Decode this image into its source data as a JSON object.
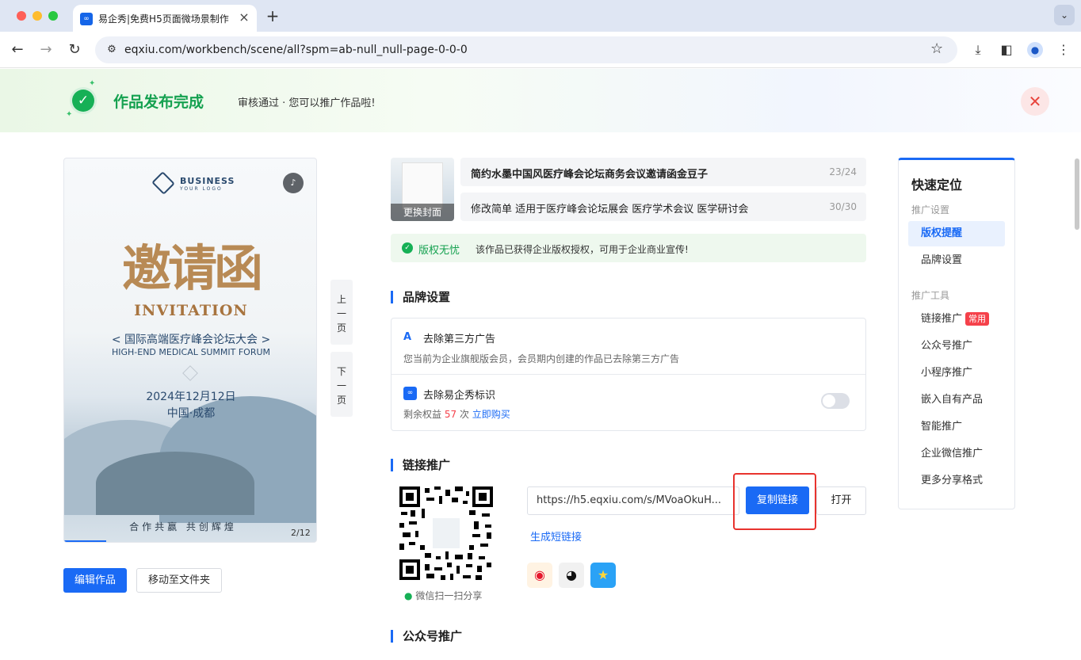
{
  "browser": {
    "tab_title": "易企秀|免费H5页面微场景制作",
    "tab_favicon": "∞",
    "url": "eqxiu.com/workbench/scene/all?spm=ab-null_null-page-0-0-0"
  },
  "banner": {
    "title": "作品发布完成",
    "subtitle": "审核通过 · 您可以推广作品啦!"
  },
  "preview": {
    "logo_top": "BUSINESS",
    "logo_bottom": "YOUR LOGO",
    "headline": "邀请函",
    "invitation": "INVITATION",
    "forum_cn": "< 国际高端医疗峰会论坛大会 >",
    "forum_en": "HIGH-END MEDICAL SUMMIT FORUM",
    "date": "2024年12月12日",
    "city": "中国·成都",
    "slogan": "合作共赢  共创辉煌",
    "page_indicator": "2/12",
    "progress": 0.167
  },
  "pager": {
    "prev": "上一页",
    "next": "下一页"
  },
  "actions": {
    "edit": "编辑作品",
    "move": "移动至文件夹"
  },
  "work": {
    "cover_button": "更换封面",
    "title": "简约水墨中国风医疗峰会论坛商务会议邀请函金豆子",
    "title_count": "23/24",
    "description": "修改简单 适用于医疗峰会论坛展会  医疗学术会议 医学研讨会",
    "description_count": "30/30",
    "copyright_label": "版权无忧",
    "copyright_text": "该作品已获得企业版权授权，可用于企业商业宣传!"
  },
  "brand": {
    "heading": "品牌设置",
    "remove_ads_title": "去除第三方广告",
    "remove_ads_desc": "您当前为企业旗舰版会员，会员期内创建的作品已去除第三方广告",
    "remove_logo_title": "去除易企秀标识",
    "remaining_label": "剩余权益",
    "remaining_count": "57",
    "remaining_unit": "次",
    "buy_link": "立即购买"
  },
  "link_promo": {
    "heading": "链接推广",
    "link_value": "https://h5.eqxiu.com/s/MVoaOkuH...",
    "copy_button": "复制链接",
    "open_button": "打开",
    "short_link": "生成短链接",
    "wechat_scan": "微信扫一扫分享"
  },
  "wechat_heading": "公众号推广",
  "quicknav": {
    "title": "快速定位",
    "group1": "推广设置",
    "group2": "推广工具",
    "items_settings": [
      "版权提醒",
      "品牌设置"
    ],
    "items_tools": [
      "链接推广",
      "公众号推广",
      "小程序推广",
      "嵌入自有产品",
      "智能推广",
      "企业微信推广",
      "更多分享格式"
    ],
    "tag_common": "常用"
  },
  "colors": {
    "accent": "#1a6af5",
    "success": "#16b056",
    "danger": "#e8332e"
  }
}
